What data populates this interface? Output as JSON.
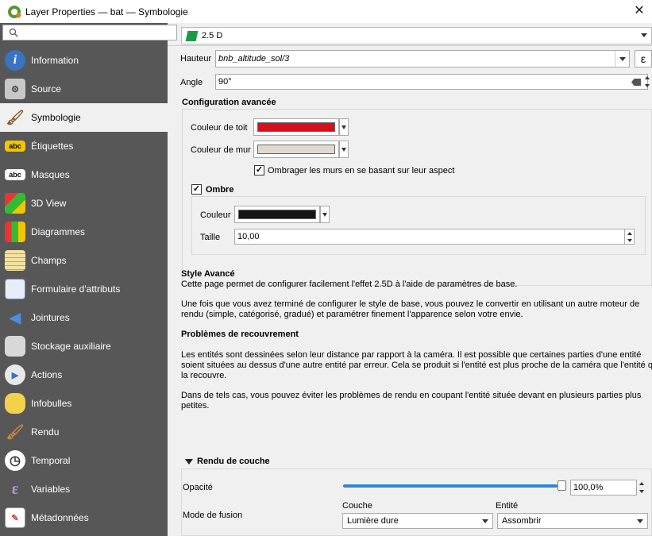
{
  "window": {
    "title": "Layer Properties — bat — Symbologie",
    "close": "✕"
  },
  "sidebar": {
    "search_placeholder": "",
    "items": [
      {
        "label": "Information",
        "icon": "info-icon"
      },
      {
        "label": "Source",
        "icon": "source-icon"
      },
      {
        "label": "Symbologie",
        "icon": "symbology-icon",
        "active": true
      },
      {
        "label": "Étiquettes",
        "icon": "labels-icon"
      },
      {
        "label": "Masques",
        "icon": "masks-icon"
      },
      {
        "label": "3D View",
        "icon": "3d-view-icon"
      },
      {
        "label": "Diagrammes",
        "icon": "diagrams-icon"
      },
      {
        "label": "Champs",
        "icon": "fields-icon"
      },
      {
        "label": "Formulaire d'attributs",
        "icon": "attributes-form-icon"
      },
      {
        "label": "Jointures",
        "icon": "joins-icon"
      },
      {
        "label": "Stockage auxiliaire",
        "icon": "auxiliary-storage-icon"
      },
      {
        "label": "Actions",
        "icon": "actions-icon"
      },
      {
        "label": "Infobulles",
        "icon": "display-icon"
      },
      {
        "label": "Rendu",
        "icon": "rendering-icon"
      },
      {
        "label": "Temporal",
        "icon": "temporal-icon"
      },
      {
        "label": "Variables",
        "icon": "variables-icon"
      },
      {
        "label": "Métadonnées",
        "icon": "metadata-icon"
      }
    ]
  },
  "renderer": {
    "selected": "2.5 D"
  },
  "height": {
    "label": "Hauteur",
    "value": "bnb_altitude_sol/3",
    "expr": "ε"
  },
  "angle": {
    "label": "Angle",
    "value": "90°"
  },
  "advanced": {
    "title": "Configuration avancée",
    "roof_label": "Couleur de toit",
    "roof_color": "#d4101c",
    "wall_label": "Couleur de mur",
    "wall_color": "#e1d8d2",
    "shade_label": "Ombrager les murs en se basant sur leur aspect",
    "shade_checked": true,
    "shadow": {
      "title": "Ombre",
      "checked": true,
      "color_label": "Couleur",
      "color": "#151515",
      "size_label": "Taille",
      "size_value": "10,00"
    }
  },
  "help": {
    "title1": "Style Avancé",
    "p1": "Cette page permet de configurer facilement l'effet 2.5D à l'aide de paramètres de base.",
    "p2a": "Une fois que vous avez terminé de configurer le style de base, vous pouvez le convertir en utilisant un autre moteur de",
    "p2b": "rendu (simple, catégorisé, gradué) et paramétrer finement l'apparence selon votre envie.",
    "title2": "Problèmes de recouvrement",
    "p3a": "Les entités sont dessinées selon leur distance par rapport à la caméra. Il est possible que certaines parties d'une entité",
    "p3b": "soient situées au dessus d'une autre entité par erreur. Cela se produit si l'entité est plus proche de la caméra que l'entité qu",
    "p3c": "la recouvre.",
    "p4a": "Dans de tels cas, vous pouvez éviter les problèmes de rendu en coupant l'entité située devant en plusieurs parties plus",
    "p4b": "petites."
  },
  "layer_render": {
    "title": "Rendu de couche",
    "opacity_label": "Opacité",
    "opacity_value": "100,0%",
    "opacity_fraction": 1.0,
    "blend_label": "Mode de fusion",
    "layer_col": "Couche",
    "feature_col": "Entité",
    "layer_mode": "Lumière dure",
    "feature_mode": "Assombrir"
  }
}
